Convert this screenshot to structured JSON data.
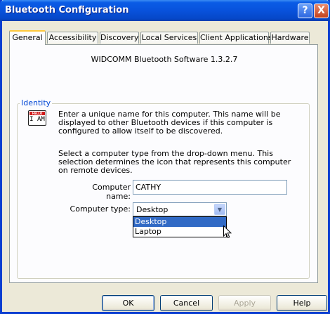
{
  "window": {
    "title": "Bluetooth Configuration",
    "help_glyph": "?",
    "close_glyph": "X"
  },
  "tabs": [
    {
      "label": "General",
      "active": true
    },
    {
      "label": "Accessibility",
      "active": false
    },
    {
      "label": "Discovery",
      "active": false
    },
    {
      "label": "Local Services",
      "active": false
    },
    {
      "label": "Client Applications",
      "active": false
    },
    {
      "label": "Hardware",
      "active": false
    }
  ],
  "general": {
    "version_text": "WIDCOMM Bluetooth Software 1.3.2.7",
    "identity": {
      "group_label": "Identity",
      "icon": {
        "name": "i-am-name-tag-icon",
        "tag_text": "HELLO",
        "text": "I AM"
      },
      "description_1": "Enter a unique name for this computer.  This name will be displayed to other Bluetooth devices if this computer is configured to allow itself to be discovered.",
      "description_2": "Select a computer type from the drop-down menu.  This selection determines the icon that represents this computer on remote devices.",
      "computer_name_label": "Computer name:",
      "computer_name_value": "CATHY",
      "computer_type_label": "Computer type:",
      "computer_type_value": "Desktop",
      "computer_type_options": [
        {
          "label": "Desktop",
          "selected": true
        },
        {
          "label": "Laptop",
          "selected": false
        }
      ]
    }
  },
  "buttons": {
    "ok": "OK",
    "cancel": "Cancel",
    "apply": "Apply",
    "help": "Help"
  },
  "colors": {
    "titlebar": "#0852dc",
    "group_label": "#0046d5",
    "selection": "#316ac5",
    "active_tab_accent": "#ffc83c"
  }
}
